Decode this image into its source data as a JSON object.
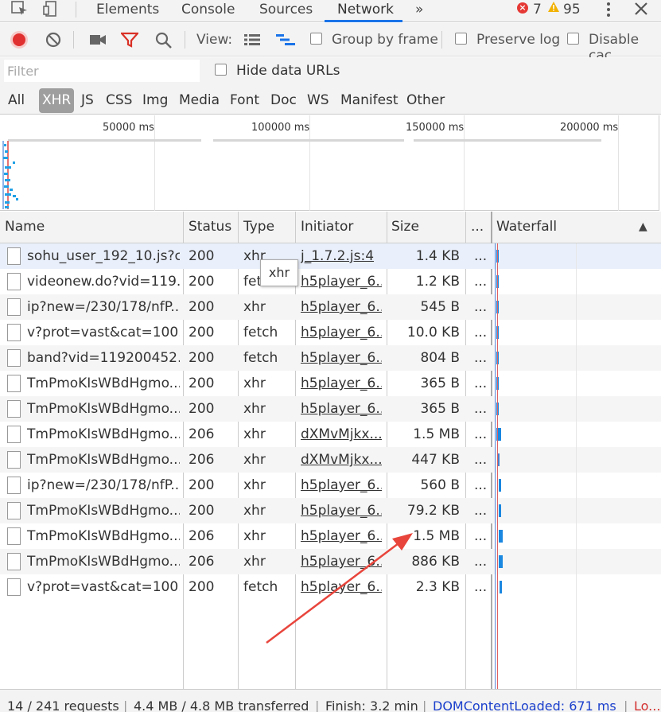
{
  "tabs": {
    "elements": "Elements",
    "console": "Console",
    "sources": "Sources",
    "network": "Network",
    "more": "»",
    "error_count": "7",
    "warning_count": "95"
  },
  "toolbar": {
    "view_label": "View:",
    "group_by_frame": "Group by frame",
    "preserve_log": "Preserve log",
    "disable_cache": "Disable cac"
  },
  "filter": {
    "placeholder": "Filter",
    "hide_data_urls": "Hide data URLs"
  },
  "type_filters": [
    "All",
    "XHR",
    "JS",
    "CSS",
    "Img",
    "Media",
    "Font",
    "Doc",
    "WS",
    "Manifest",
    "Other"
  ],
  "overview": {
    "ticks": [
      "50000 ms",
      "100000 ms",
      "150000 ms",
      "200000 ms"
    ]
  },
  "columns": {
    "name": "Name",
    "status": "Status",
    "type": "Type",
    "initiator": "Initiator",
    "size": "Size",
    "more": "...",
    "waterfall": "Waterfall",
    "sort_icon": "▲"
  },
  "tooltip": "xhr",
  "rows": [
    {
      "name": "sohu_user_192_10.js?c...",
      "status": "200",
      "type": "xhr",
      "initiator": "j_1.7.2.js:4",
      "size": "1.4 KB",
      "dots": "..."
    },
    {
      "name": "videonew.do?vid=119...",
      "status": "200",
      "type": "fetch",
      "initiator": "h5player_6...",
      "size": "1.2 KB",
      "dots": "..."
    },
    {
      "name": "ip?new=/230/178/nfP...",
      "status": "200",
      "type": "xhr",
      "initiator": "h5player_6...",
      "size": "545 B",
      "dots": "..."
    },
    {
      "name": "v?prot=vast&cat=100...",
      "status": "200",
      "type": "fetch",
      "initiator": "h5player_6...",
      "size": "10.0 KB",
      "dots": "..."
    },
    {
      "name": "band?vid=119200452...",
      "status": "200",
      "type": "fetch",
      "initiator": "h5player_6...",
      "size": "804 B",
      "dots": "..."
    },
    {
      "name": "TmPmoKIsWBdHgmo...",
      "status": "200",
      "type": "xhr",
      "initiator": "h5player_6...",
      "size": "365 B",
      "dots": "..."
    },
    {
      "name": "TmPmoKIsWBdHgmo...",
      "status": "200",
      "type": "xhr",
      "initiator": "h5player_6...",
      "size": "365 B",
      "dots": "..."
    },
    {
      "name": "TmPmoKIsWBdHgmo...",
      "status": "206",
      "type": "xhr",
      "initiator": "dXMvMjkx...",
      "size": "1.5 MB",
      "dots": "..."
    },
    {
      "name": "TmPmoKIsWBdHgmo...",
      "status": "206",
      "type": "xhr",
      "initiator": "dXMvMjkx...",
      "size": "447 KB",
      "dots": "..."
    },
    {
      "name": "ip?new=/230/178/nfP...",
      "status": "200",
      "type": "xhr",
      "initiator": "h5player_6...",
      "size": "560 B",
      "dots": "..."
    },
    {
      "name": "TmPmoKIsWBdHgmo...",
      "status": "200",
      "type": "xhr",
      "initiator": "h5player_6...",
      "size": "79.2 KB",
      "dots": "..."
    },
    {
      "name": "TmPmoKIsWBdHgmo...",
      "status": "206",
      "type": "xhr",
      "initiator": "h5player_6...",
      "size": "1.5 MB",
      "dots": "..."
    },
    {
      "name": "TmPmoKIsWBdHgmo...",
      "status": "206",
      "type": "xhr",
      "initiator": "h5player_6...",
      "size": "886 KB",
      "dots": "..."
    },
    {
      "name": "v?prot=vast&cat=100...",
      "status": "200",
      "type": "fetch",
      "initiator": "h5player_6...",
      "size": "2.3 KB",
      "dots": "..."
    }
  ],
  "status_bar": {
    "requests": "14 / 241 requests",
    "transferred": "4.4 MB / 4.8 MB transferred",
    "finish": "Finish: 3.2 min",
    "dom_content_loaded": "DOMContentLoaded: 671 ms",
    "load": "Lo..."
  },
  "colors": {
    "accent": "#1a73e8",
    "record_red": "#e0302f",
    "filter_red": "#d93025",
    "error_red": "#e53935",
    "warning_yellow": "#f2b100",
    "dcl_blue": "#1a3fcc",
    "load_red": "#d32f2f",
    "annotation_arrow": "#e8453c"
  }
}
